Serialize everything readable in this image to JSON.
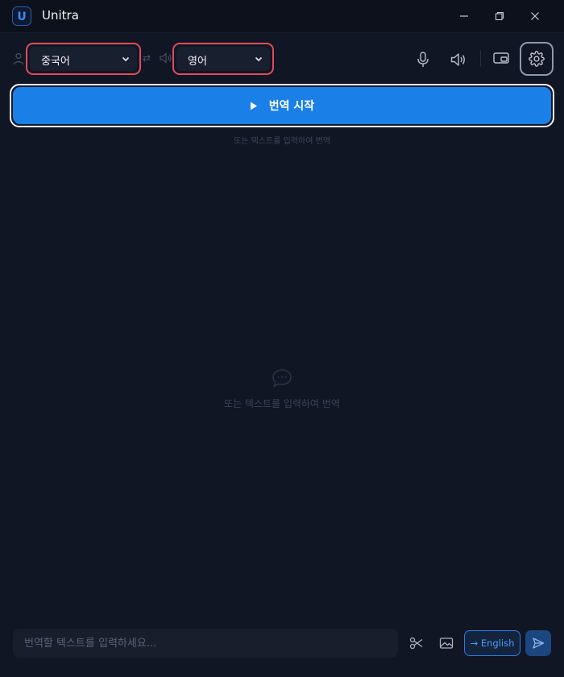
{
  "app": {
    "title": "Unitra",
    "logo_letter": "U"
  },
  "toolbar": {
    "source_language": "중국어",
    "target_language": "영어",
    "swap_symbol": "⇄"
  },
  "main": {
    "start_label": "번역 시작",
    "hint_text": "또는 텍스트를 입력하여 번역",
    "empty_state_text": "또는 텍스트를 입력하여 번역"
  },
  "input_bar": {
    "placeholder": "번역할 텍스트를 입력하세요...",
    "target_chip_label": "→ English"
  },
  "colors": {
    "accent": "#1a7fe6",
    "highlight_border": "#e24b5a",
    "background": "#111624"
  },
  "icons": [
    "app-logo-icon",
    "minimize-icon",
    "restore-icon",
    "close-icon",
    "person-icon",
    "chevron-down-icon",
    "swap-icon",
    "speaker-icon",
    "microphone-icon",
    "picture-in-picture-icon",
    "gear-icon",
    "play-icon",
    "chat-bubble-icon",
    "scissors-icon",
    "image-icon",
    "send-icon"
  ]
}
